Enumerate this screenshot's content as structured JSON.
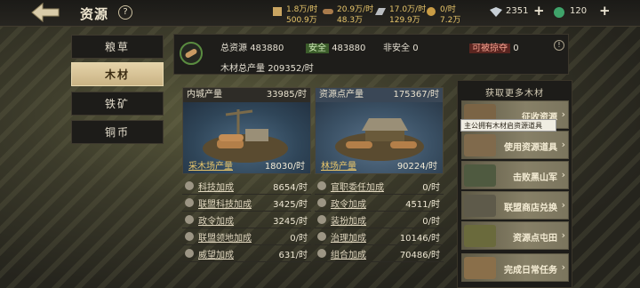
{
  "header": {
    "title": "资源",
    "help": "?",
    "resources": [
      {
        "icon": "grain-icon",
        "line1": "1.8万/时",
        "line2": "500.9万"
      },
      {
        "icon": "wood-icon",
        "line1": "20.9万/时",
        "line2": "48.3万"
      },
      {
        "icon": "iron-icon",
        "line1": "17.0万/时",
        "line2": "129.9万"
      },
      {
        "icon": "coin-icon",
        "line1": "0/时",
        "line2": "7.2万"
      }
    ],
    "jade": "2351",
    "gem": "120"
  },
  "tabs": [
    "粮草",
    "木材",
    "铁矿",
    "铜币"
  ],
  "active_tab": "木材",
  "summary": {
    "total_label": "总资源",
    "total_value": "483880",
    "safe_label": "安全",
    "safe_value": "483880",
    "unsafe_label": "非安全",
    "unsafe_value": "0",
    "plunder_label": "可被掠夺",
    "plunder_value": "0",
    "output_label": "木材总产量",
    "output_value": "209352/时"
  },
  "inner": {
    "head_label": "内城产量",
    "head_value": "33985/时",
    "foot_label": "采木场产量",
    "foot_value": "18030/时"
  },
  "point": {
    "head_label": "资源点产量",
    "head_value": "175367/时",
    "foot_label": "林场产量",
    "foot_value": "90224/时"
  },
  "inner_bonus": [
    {
      "label": "科技加成",
      "value": "8654/时",
      "icon": "tech-icon"
    },
    {
      "label": "联盟科技加成",
      "value": "3425/时",
      "icon": "alliance-tech-icon"
    },
    {
      "label": "政令加成",
      "value": "3245/时",
      "icon": "decree-icon"
    },
    {
      "label": "联盟领地加成",
      "value": "0/时",
      "icon": "territory-icon"
    },
    {
      "label": "威望加成",
      "value": "631/时",
      "icon": "prestige-icon"
    }
  ],
  "point_bonus": [
    {
      "label": "官职委任加成",
      "value": "0/时",
      "icon": "official-icon"
    },
    {
      "label": "政令加成",
      "value": "4511/时",
      "icon": "decree-icon"
    },
    {
      "label": "装扮加成",
      "value": "0/时",
      "icon": "dress-icon"
    },
    {
      "label": "治理加成",
      "value": "10146/时",
      "icon": "govern-icon"
    },
    {
      "label": "组合加成",
      "value": "70486/时",
      "icon": "combo-icon"
    }
  ],
  "right": {
    "title": "获取更多木材",
    "tooltip": "主公拥有木材启资源道具",
    "cards": [
      "征收资源",
      "使用资源道具",
      "击败黑山军",
      "联盟商店兑换",
      "资源点屯田",
      "完成日常任务"
    ]
  },
  "colors": {
    "accent": "#e7c56a",
    "tab_active": "#d8c497",
    "safe": "#3c5d2b",
    "plunder": "#5a2520"
  }
}
